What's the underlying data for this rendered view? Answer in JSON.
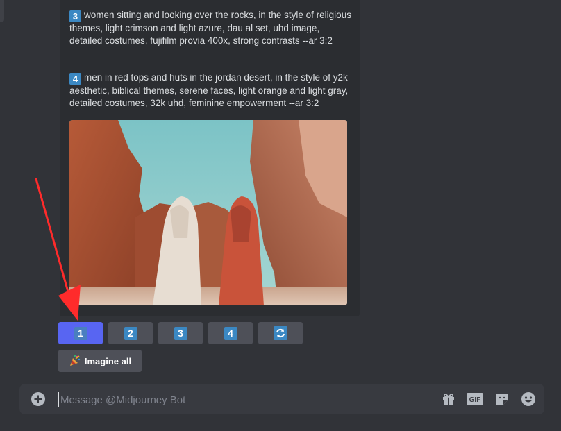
{
  "prompts": [
    {
      "number": "3",
      "text": "women sitting and looking over the rocks, in the style of religious themes, light crimson and light azure, dau al set, uhd image, detailed costumes, fujifilm provia 400x, strong contrasts --ar 3:2"
    },
    {
      "number": "4",
      "text": "men in red tops and huts in the jordan desert, in the style of y2k aesthetic, biblical themes, serene faces, light orange and light gray, detailed costumes, 32k uhd, feminine empowerment --ar 3:2"
    }
  ],
  "image_buttons": [
    {
      "label": "1",
      "selected": true
    },
    {
      "label": "2",
      "selected": false
    },
    {
      "label": "3",
      "selected": false
    },
    {
      "label": "4",
      "selected": false
    }
  ],
  "reroll_icon": "counterclockwise-arrows-icon",
  "imagine_all": {
    "label": "Imagine all",
    "icon": "party-popper-icon"
  },
  "composer": {
    "placeholder": "Message @Midjourney Bot"
  },
  "toolbar_icons": [
    "add-icon",
    "gift-icon",
    "gif-icon",
    "sticker-icon",
    "emoji-icon"
  ],
  "colors": {
    "accent": "#5865f2",
    "keycap": "#3b88c3",
    "arrow": "#ff2b2b"
  }
}
